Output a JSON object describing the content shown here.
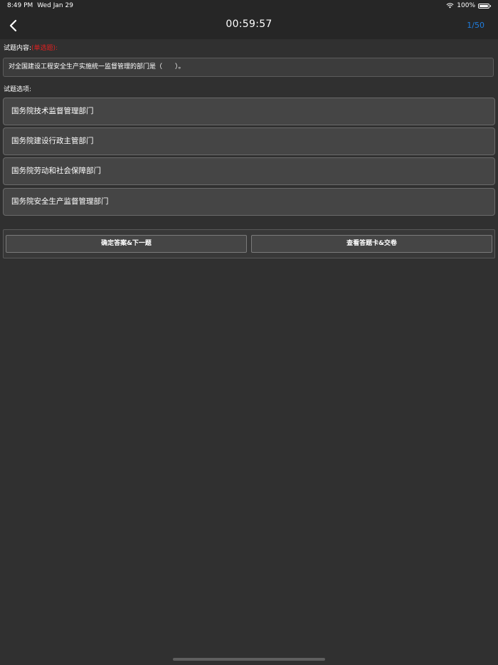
{
  "status_bar": {
    "time": "8:49 PM",
    "date": "Wed Jan 29",
    "battery": "100%"
  },
  "nav": {
    "timer": "00:59:57",
    "progress": "1/50"
  },
  "question": {
    "content_label": "试题内容:",
    "type_label": "(单选题):",
    "text": "对全国建设工程安全生产实施统一监督管理的部门是（　　）。",
    "options_label": "试题选项:",
    "options": [
      "国务院技术监督管理部门",
      "国务院建设行政主管部门",
      "国务院劳动和社会保障部门",
      "国务院安全生产监督管理部门"
    ]
  },
  "actions": {
    "confirm_next": "确定答案&下一题",
    "view_card_submit": "查看答题卡&交卷"
  },
  "colors": {
    "background": "#303030",
    "accent": "#1f7ee0",
    "question_type": "#e02020"
  }
}
